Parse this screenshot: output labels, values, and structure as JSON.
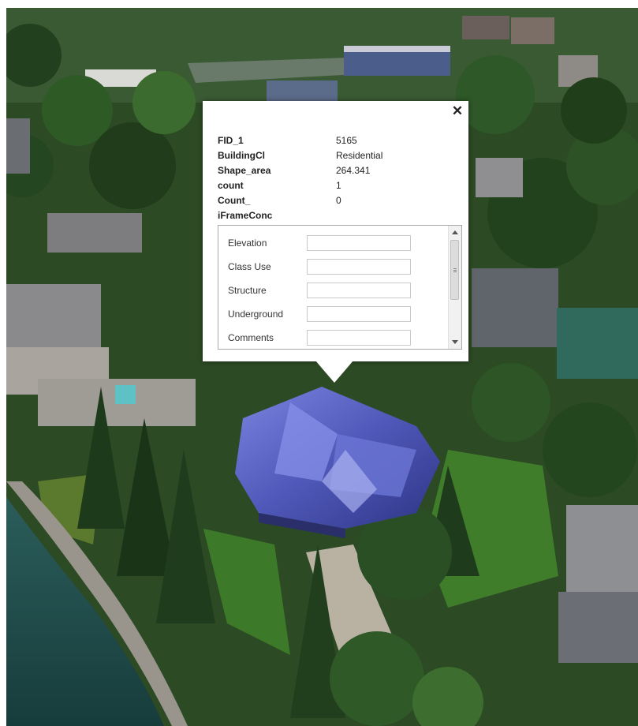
{
  "popup": {
    "close_icon": "close-icon",
    "attributes": [
      {
        "key": "FID_1",
        "value": "5165"
      },
      {
        "key": "BuildingCl",
        "value": "Residential"
      },
      {
        "key": "Shape_area",
        "value": "264.341"
      },
      {
        "key": "count",
        "value": "1"
      },
      {
        "key": "Count_",
        "value": "0"
      },
      {
        "key": "iFrameConc",
        "value": ""
      }
    ],
    "form_fields": [
      {
        "label": "Elevation",
        "value": ""
      },
      {
        "label": "Class Use",
        "value": ""
      },
      {
        "label": "Structure",
        "value": ""
      },
      {
        "label": "Underground",
        "value": ""
      },
      {
        "label": "Comments",
        "value": ""
      }
    ]
  },
  "map": {
    "view": "3D aerial scene",
    "colors": {
      "water": "#1f4e4c",
      "lawn": "#3c7a2a",
      "trees": "#213d1c",
      "roof_highlight": "#5a63c9"
    }
  }
}
